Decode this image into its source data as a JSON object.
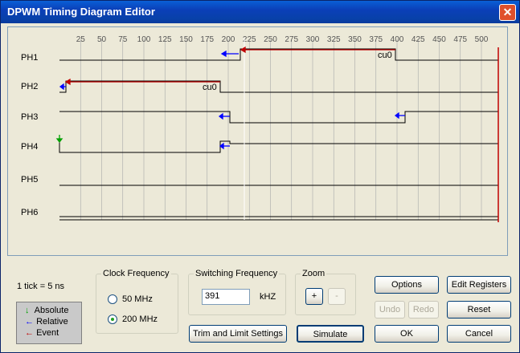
{
  "window": {
    "title": "DPWM Timing Diagram Editor",
    "close_glyph": "✕"
  },
  "diagram": {
    "ticks": [
      "25",
      "50",
      "75",
      "100",
      "125",
      "150",
      "175",
      "200",
      "225",
      "250",
      "275",
      "300",
      "325",
      "350",
      "375",
      "400",
      "425",
      "450",
      "475",
      "500"
    ],
    "channels": [
      "PH1",
      "PH2",
      "PH3",
      "PH4",
      "PH5",
      "PH6"
    ],
    "event_labels": {
      "ph1": "cu0",
      "ph2": "cu0"
    },
    "colors": {
      "absolute": "#00a000",
      "relative": "#0000ff",
      "event": "#c00000"
    }
  },
  "tick_info": "1 tick = 5 ns",
  "legend": {
    "absolute": "Absolute",
    "relative": "Relative",
    "event": "Event"
  },
  "clock": {
    "title": "Clock Frequency",
    "options": [
      "50 MHz",
      "200 MHz"
    ],
    "selected": "200 MHz"
  },
  "switching": {
    "title": "Switching Frequency",
    "value": "391",
    "unit": "kHZ"
  },
  "zoom": {
    "title": "Zoom",
    "in_label": "+",
    "out_label": "-"
  },
  "buttons": {
    "options": "Options",
    "edit_registers": "Edit Registers",
    "undo": "Undo",
    "redo": "Redo",
    "reset": "Reset",
    "trim": "Trim and Limit Settings",
    "simulate": "Simulate",
    "ok": "OK",
    "cancel": "Cancel"
  }
}
